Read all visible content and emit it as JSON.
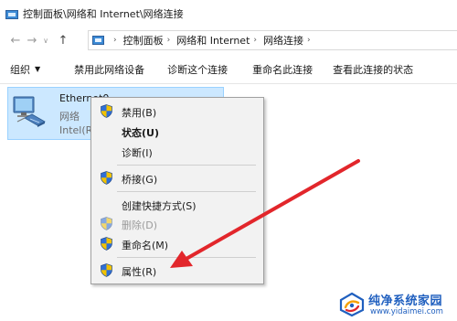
{
  "window": {
    "title": "控制面板\\网络和 Internet\\网络连接",
    "title_icon": "control-panel-icon"
  },
  "navigation": {
    "back_icon": "←",
    "forward_icon": "→",
    "dropdown_icon": "∨",
    "up_icon": "↑"
  },
  "address_bar": {
    "icon": "control-panel-icon",
    "separator": "›",
    "crumbs": [
      "控制面板",
      "网络和 Internet",
      "网络连接"
    ]
  },
  "toolbar": {
    "organize_label": "组织",
    "organize_caret": "▼",
    "items": [
      "禁用此网络设备",
      "诊断这个连接",
      "重命名此连接",
      "查看此连接的状态"
    ]
  },
  "adapter": {
    "name": "Ethernet0",
    "status": "网络",
    "device": "Intel(R)",
    "icon": "network-adapter-icon",
    "selected": true
  },
  "context_menu": {
    "items": [
      {
        "label": "禁用(B)",
        "shield": true,
        "bold": false,
        "disabled": false
      },
      {
        "label": "状态(U)",
        "shield": false,
        "bold": true,
        "disabled": false
      },
      {
        "label": "诊断(I)",
        "shield": false,
        "bold": false,
        "disabled": false
      },
      {
        "label": "桥接(G)",
        "shield": true,
        "bold": false,
        "disabled": false
      },
      {
        "label": "创建快捷方式(S)",
        "shield": false,
        "bold": false,
        "disabled": false
      },
      {
        "label": "删除(D)",
        "shield": true,
        "bold": false,
        "disabled": true
      },
      {
        "label": "重命名(M)",
        "shield": true,
        "bold": false,
        "disabled": false
      },
      {
        "label": "属性(R)",
        "shield": true,
        "bold": false,
        "disabled": false
      }
    ]
  },
  "annotation": {
    "arrow_color": "#e2262b",
    "points_to": "属性(R)"
  },
  "watermark": {
    "title": "纯净系统家园",
    "url": "www.yidaimei.com",
    "logo_colors": [
      "#1f5fbf",
      "#f5a000",
      "#e2262b"
    ]
  },
  "colors": {
    "selection_bg": "#cce8ff",
    "selection_border": "#99d1ff",
    "menu_bg": "#f2f2f2",
    "shield_blue": "#2f6fd6",
    "shield_yellow": "#f2c200"
  }
}
